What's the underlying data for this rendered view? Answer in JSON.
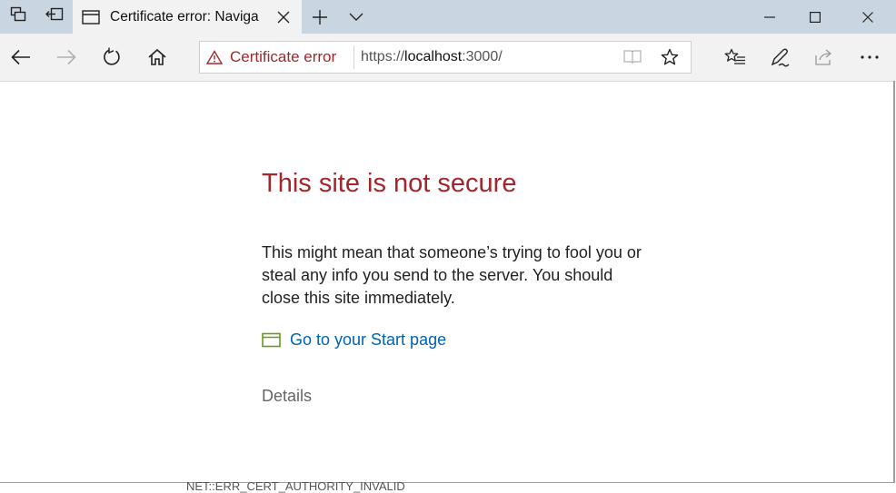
{
  "tab": {
    "title": "Certificate error: Naviga"
  },
  "address": {
    "security_label": "Certificate error",
    "url_prefix": "https://",
    "url_host": "localhost",
    "url_suffix": ":3000/"
  },
  "page": {
    "heading": "This site is not secure",
    "paragraph": "This might mean that someone’s trying to fool you or steal any info you send to the server. You should close this site immediately.",
    "start_link": "Go to your Start page",
    "details": "Details",
    "error_code": "NET::ERR_CERT_AUTHORITY_INVALID"
  },
  "colors": {
    "titlebar": "#c9d6e2",
    "toolbar": "#f2f2f2",
    "error_red": "#a4262c",
    "link_blue": "#0063b1",
    "start_icon_green": "#6a9a1f"
  },
  "icons": {
    "tab_bar": [
      "tab-preview-icon",
      "set-aside-tabs-icon"
    ],
    "nav": [
      "back-arrow-icon",
      "forward-arrow-icon",
      "refresh-icon",
      "home-icon"
    ],
    "address": [
      "warning-triangle-icon",
      "reading-view-icon",
      "favorite-star-icon"
    ],
    "toolbar": [
      "favorites-hub-icon",
      "web-note-icon",
      "share-icon",
      "more-icon"
    ],
    "window": [
      "minimize-icon",
      "maximize-icon",
      "close-icon"
    ]
  }
}
